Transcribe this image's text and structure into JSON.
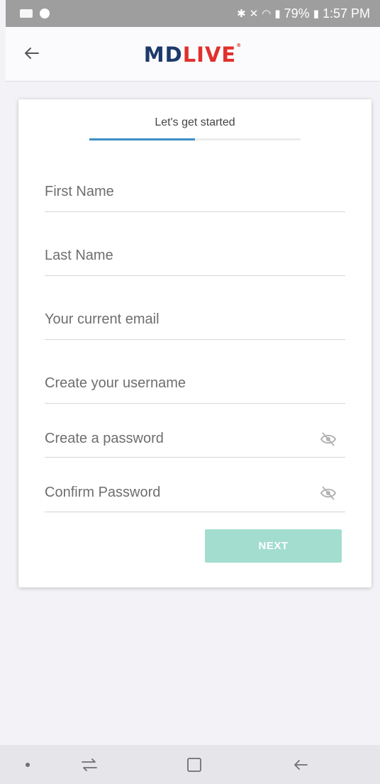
{
  "status_bar": {
    "battery": "79%",
    "time": "1:57 PM"
  },
  "header": {
    "logo_primary": "MD",
    "logo_accent": "LIVE",
    "logo_mark": "®"
  },
  "signup": {
    "step_title": "Let's get started",
    "progress": 0.5,
    "fields": {
      "first_name": "First Name",
      "last_name": "Last Name",
      "email": "Your current email",
      "username": "Create your username",
      "password": "Create a password",
      "confirm_password": "Confirm Password"
    },
    "next_label": "NEXT"
  },
  "colors": {
    "logo_navy": "#1d3a6a",
    "logo_red": "#e0312e",
    "progress_blue": "#3d8fc7",
    "next_disabled": "#a3ddd0"
  },
  "icons": [
    "back-arrow-icon",
    "eye-slash-icon",
    "recents-icon",
    "home-icon",
    "system-back-icon"
  ]
}
